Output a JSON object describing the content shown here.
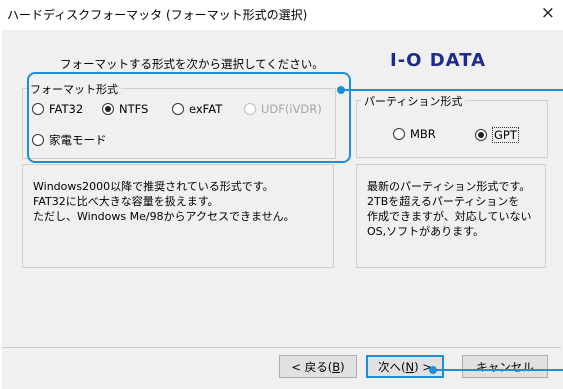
{
  "window": {
    "title": "ハードディスクフォーマッタ (フォーマット形式の選択)",
    "close_glyph": "×"
  },
  "instruction": "フォーマットする形式を次から選択してください。",
  "logo": "I-O DATA",
  "format_group": {
    "legend": "フォーマット形式",
    "options": [
      {
        "label": "FAT32",
        "selected": false,
        "enabled": true
      },
      {
        "label": "NTFS",
        "selected": true,
        "enabled": true
      },
      {
        "label": "exFAT",
        "selected": false,
        "enabled": true
      },
      {
        "label": "UDF(iVDR)",
        "selected": false,
        "enabled": false
      },
      {
        "label": "家電モード",
        "selected": false,
        "enabled": true
      }
    ]
  },
  "partition_group": {
    "legend": "パーティション形式",
    "options": [
      {
        "label": "MBR",
        "selected": false
      },
      {
        "label": "GPT",
        "selected": true
      }
    ]
  },
  "format_description": [
    "Windows2000以降で推奨されている形式です。",
    "FAT32に比べ大きな容量を扱えます。",
    "ただし、Windows Me/98からアクセスできません。"
  ],
  "partition_description": [
    "最新のパーティション形式です。",
    "2TBを超えるパーティションを",
    "作成できますが、対応していない",
    "OS,ソフトがあります。"
  ],
  "buttons": {
    "back": {
      "label": "< 戻る(",
      "key": "B",
      "suffix": ")"
    },
    "next": {
      "label": "次へ(",
      "key": "N",
      "suffix": ") >"
    },
    "cancel": {
      "label": "キャンセル"
    }
  },
  "colors": {
    "highlight": "#1e8fd6",
    "logo": "#1b2b8f"
  }
}
